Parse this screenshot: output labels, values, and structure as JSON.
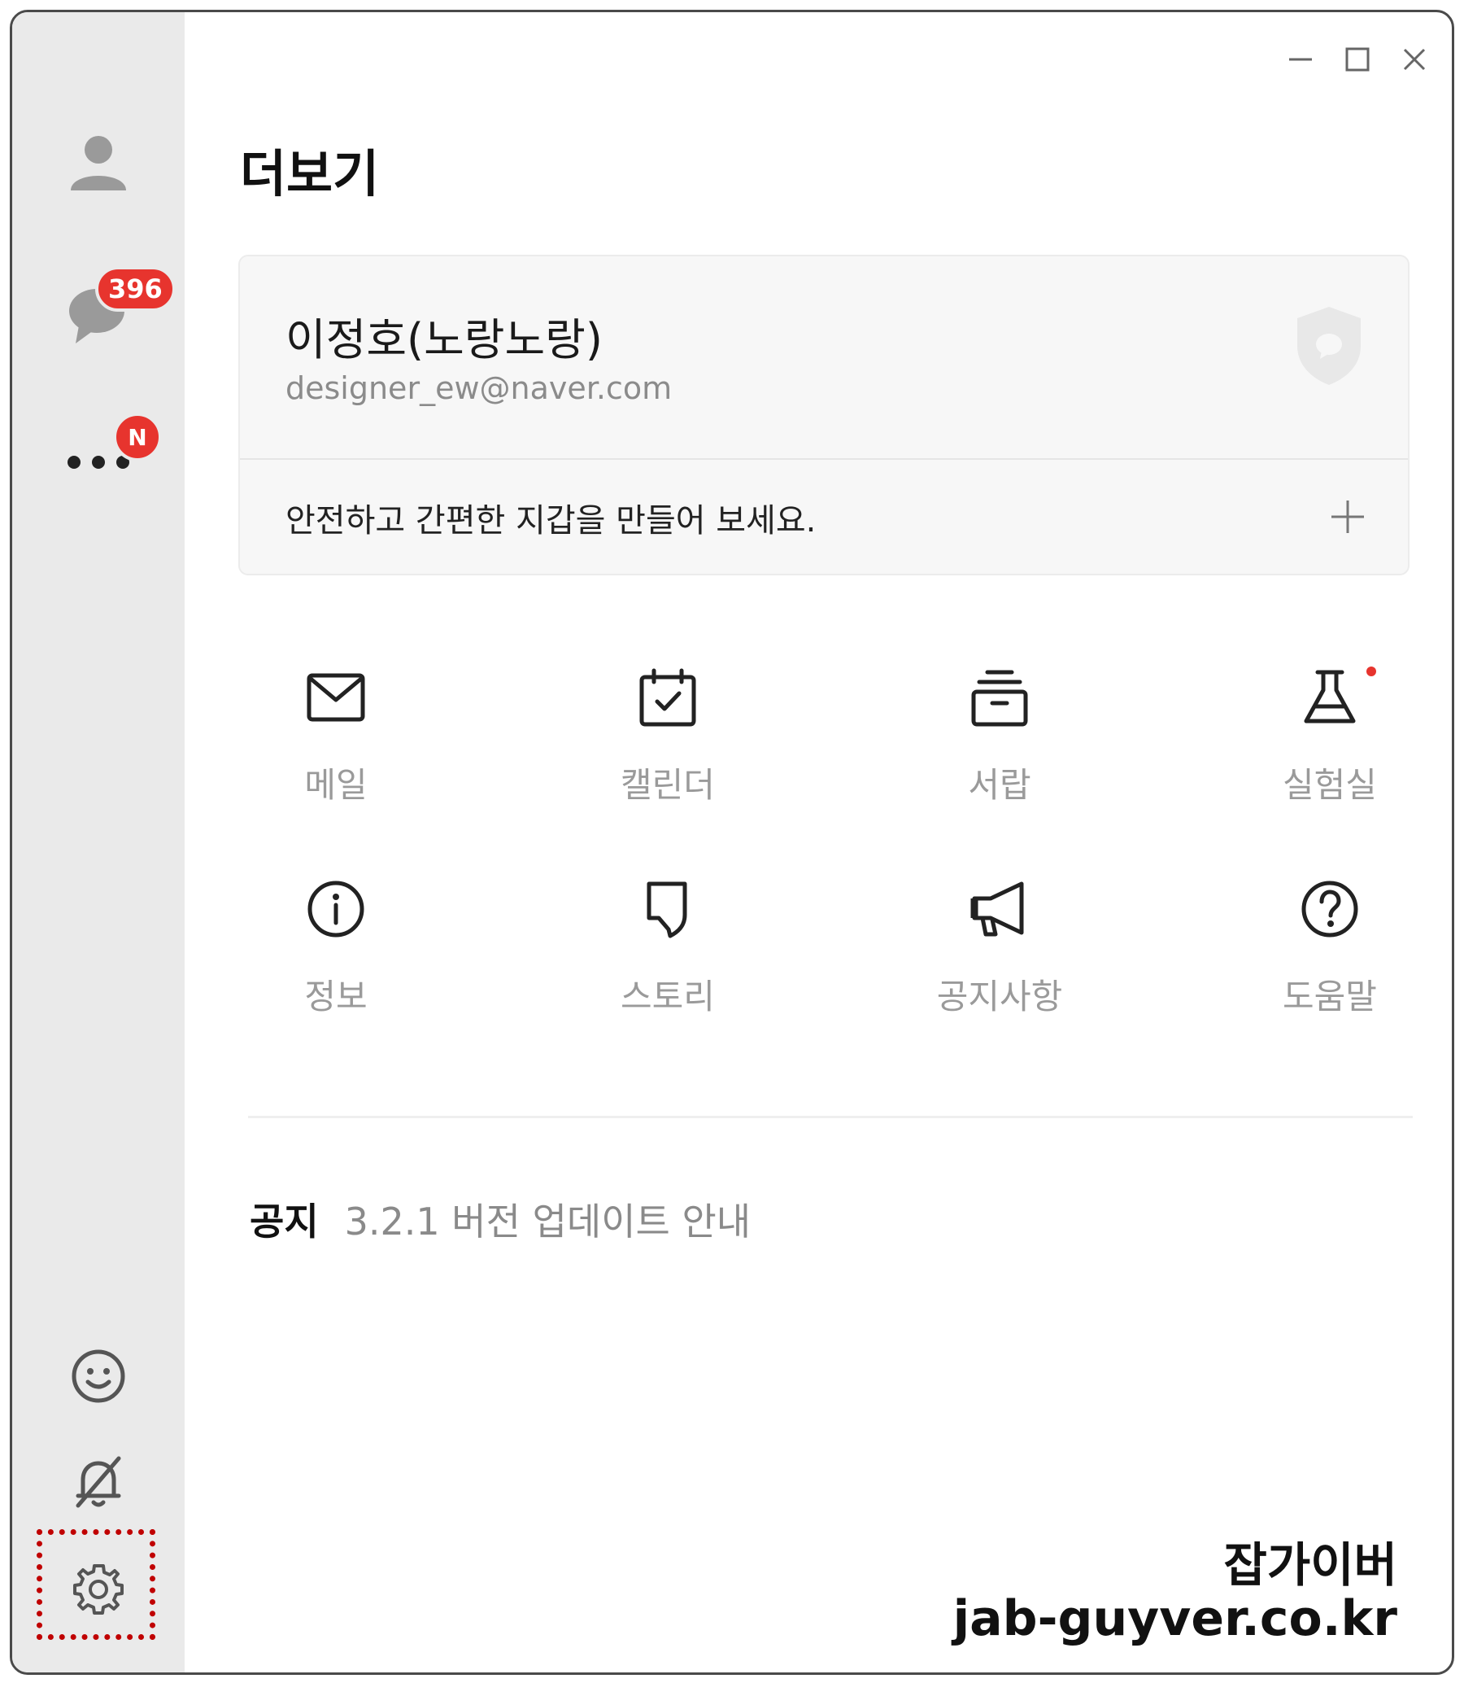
{
  "window": {
    "controls": {
      "minimize": "minimize-icon",
      "maximize": "maximize-icon",
      "close": "close-icon"
    }
  },
  "sidebar": {
    "items": [
      {
        "name": "friends",
        "icon": "person-icon"
      },
      {
        "name": "chats",
        "icon": "chat-bubble-icon",
        "badge": "396"
      },
      {
        "name": "more",
        "icon": "more-dots-icon",
        "badge": "N"
      }
    ],
    "bottom": [
      {
        "name": "emoticon",
        "icon": "smiley-icon"
      },
      {
        "name": "notifications",
        "icon": "bell-off-icon"
      },
      {
        "name": "settings",
        "icon": "gear-icon",
        "highlighted": true
      }
    ]
  },
  "page": {
    "title": "더보기"
  },
  "profile": {
    "name": "이정호(노랑노랑)",
    "email": "designer_ew@naver.com",
    "wallet_prompt": "안전하고 간편한 지갑을 만들어 보세요."
  },
  "menu": [
    {
      "label": "메일",
      "icon": "mail-icon"
    },
    {
      "label": "캘린더",
      "icon": "calendar-icon"
    },
    {
      "label": "서랍",
      "icon": "drawer-icon"
    },
    {
      "label": "실험실",
      "icon": "flask-icon",
      "has_new_dot": true
    },
    {
      "label": "정보",
      "icon": "info-icon"
    },
    {
      "label": "스토리",
      "icon": "story-icon"
    },
    {
      "label": "공지사항",
      "icon": "megaphone-icon"
    },
    {
      "label": "도움말",
      "icon": "help-icon"
    }
  ],
  "notice": {
    "label": "공지",
    "text": "3.2.1 버전 업데이트 안내"
  },
  "watermark": {
    "line1": "잡가이버",
    "line2": "jab-guyver.co.kr"
  },
  "colors": {
    "badge": "#e7342e",
    "sidebar_bg": "#eaeaea",
    "highlight_frame": "#c00000"
  }
}
